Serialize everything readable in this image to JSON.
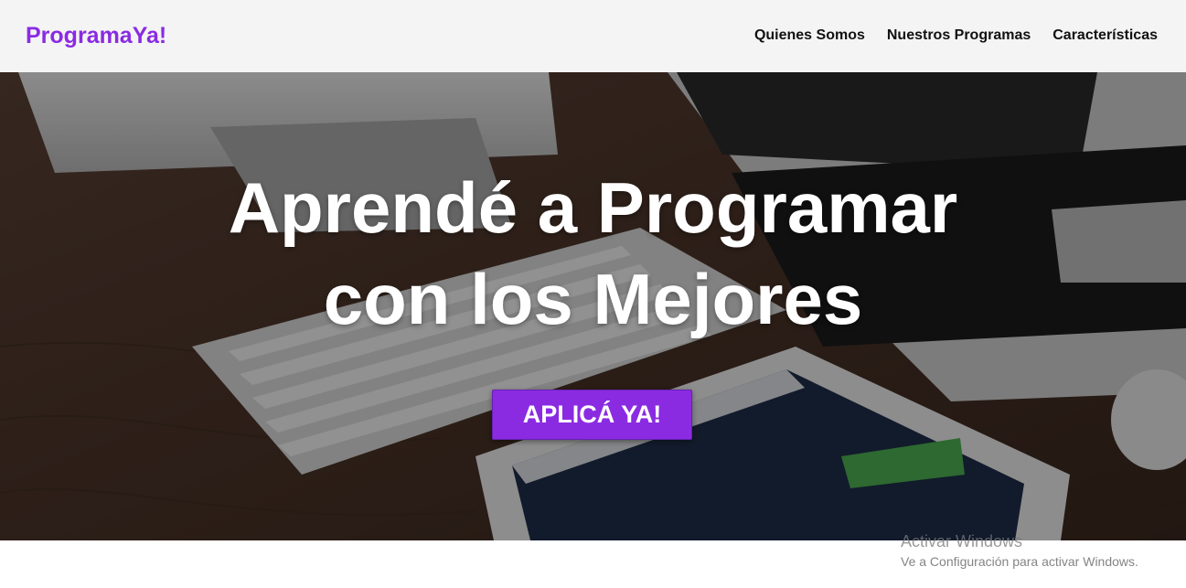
{
  "navbar": {
    "logo": "ProgramaYa!",
    "links": [
      {
        "label": "Quienes Somos"
      },
      {
        "label": "Nuestros Programas"
      },
      {
        "label": "Características"
      }
    ]
  },
  "hero": {
    "title_line1": "Aprendé a Programar",
    "title_line2": "con los Mejores",
    "cta_label": "APLICÁ YA!"
  },
  "watermark": {
    "title": "Activar Windows",
    "subtitle": "Ve a Configuración para activar Windows."
  },
  "colors": {
    "brand": "#8a2be2",
    "navbar_bg": "#f4f4f4"
  }
}
